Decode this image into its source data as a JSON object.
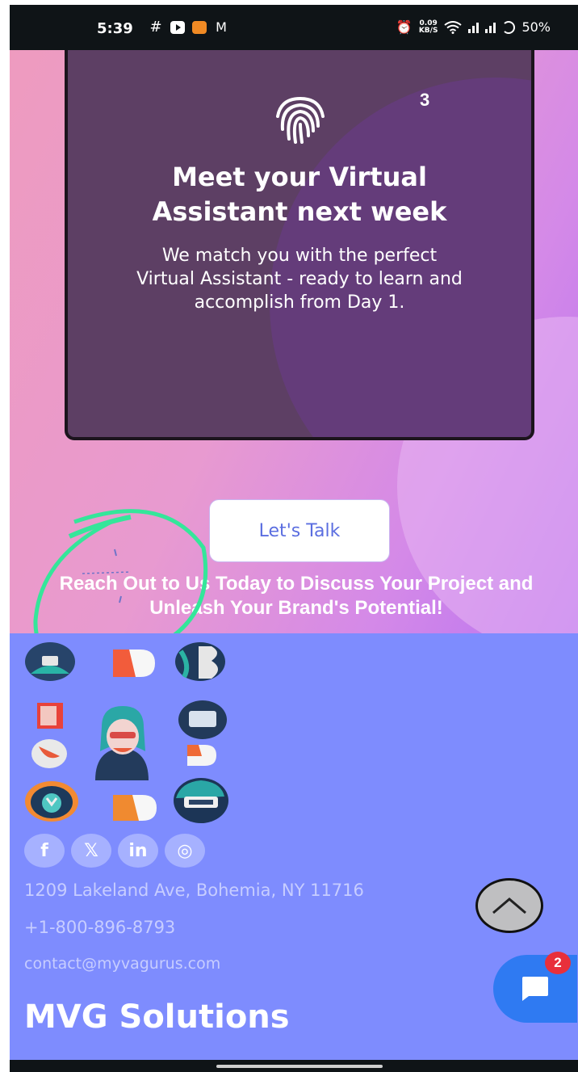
{
  "status_bar": {
    "time": "5:39",
    "net_speed": "0.09",
    "net_unit": "KB/S",
    "battery": "50%"
  },
  "hero": {
    "step_number": "3",
    "title": "Meet your Virtual Assistant next week",
    "description": "We match you with the perfect Virtual Assistant - ready to learn and accomplish from Day 1.",
    "cta_label": "Let's Talk",
    "reach_text": "Reach Out to Us Today to Discuss Your Project and Unleash Your Brand's Potential!"
  },
  "footer": {
    "social": [
      {
        "icon": "facebook-icon",
        "glyph": "f"
      },
      {
        "icon": "x-icon",
        "glyph": "𝕏"
      },
      {
        "icon": "linkedin-icon",
        "glyph": "in"
      },
      {
        "icon": "instagram-icon",
        "glyph": "◎"
      }
    ],
    "address": "1209 Lakeland Ave, Bohemia, NY 11716",
    "phone": "+1-800-896-8793",
    "email": "contact@myvagurus.com",
    "brand": "MVG Solutions"
  },
  "chat": {
    "badge_count": "2"
  },
  "colors": {
    "footer_bg": "#7e8cfe",
    "card_bg": "#5d3f64",
    "chat_blue": "#2f7af2",
    "badge_red": "#e8303b"
  }
}
